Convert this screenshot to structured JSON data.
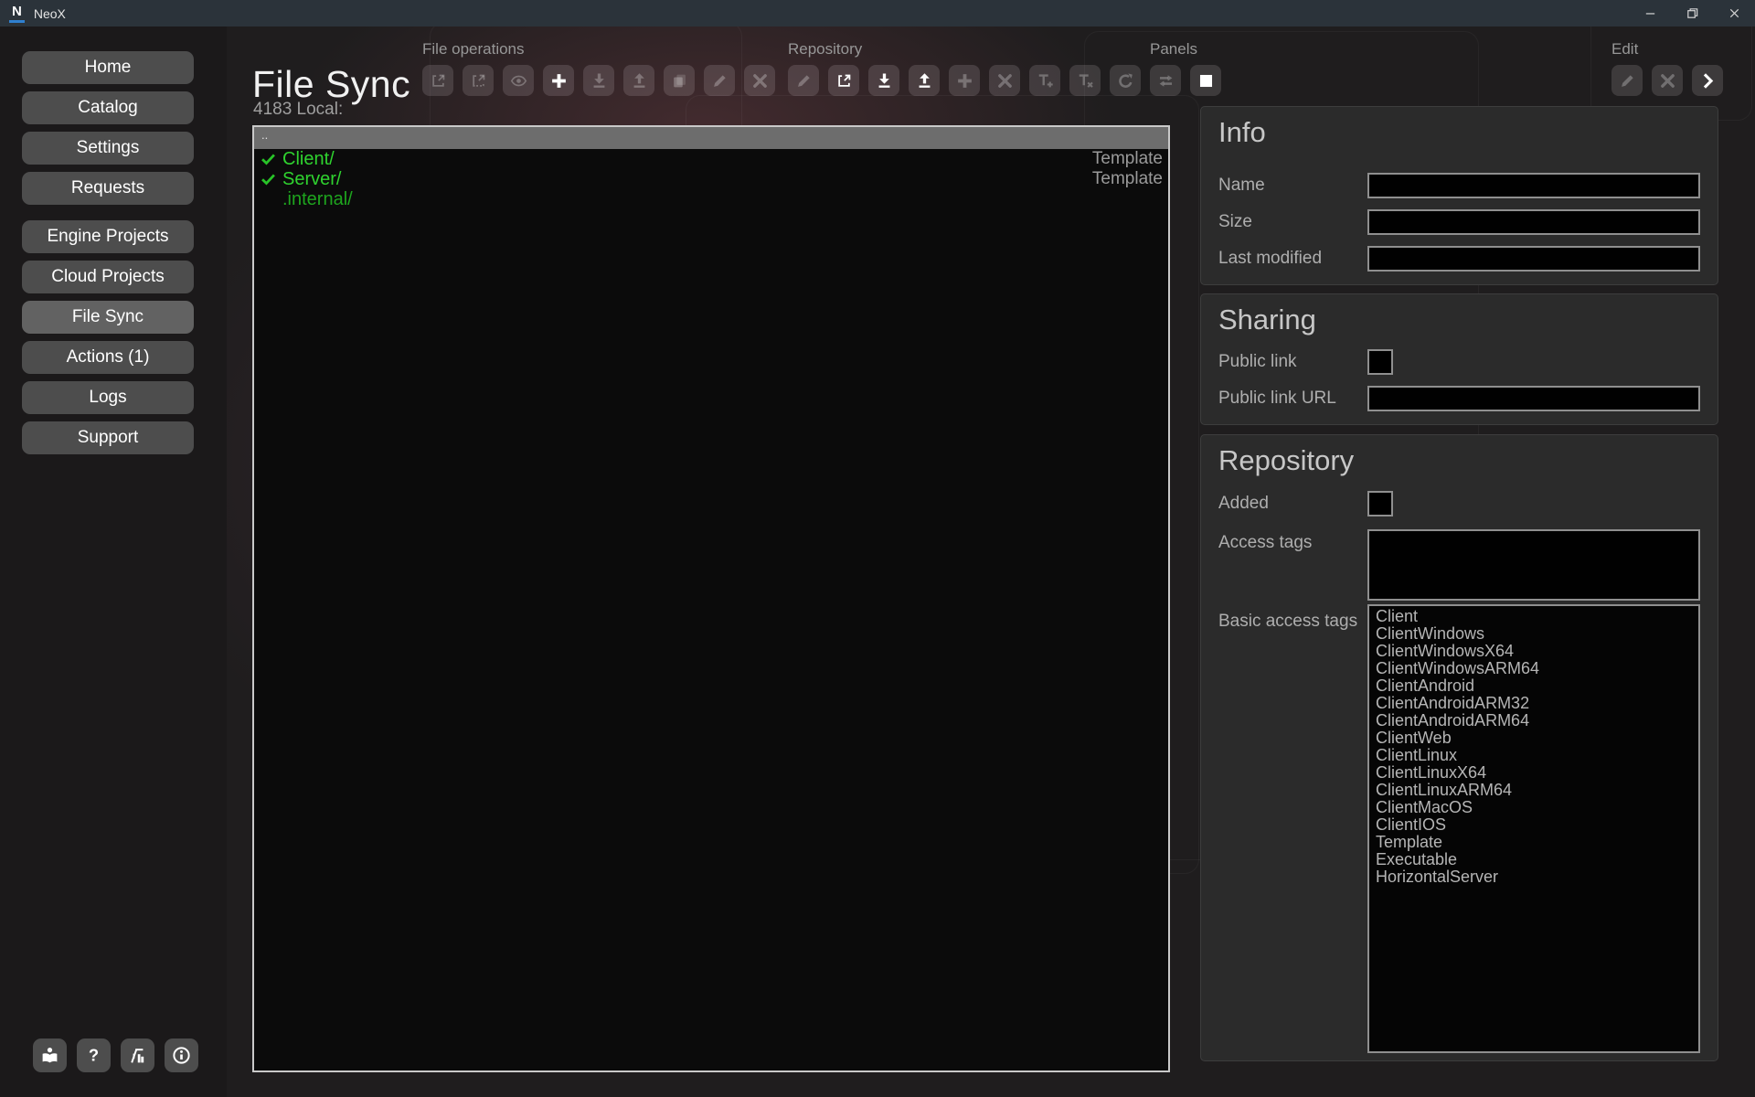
{
  "window": {
    "app_name": "NeoX",
    "logo_letter": "N",
    "controls": [
      "minimize",
      "restore",
      "close"
    ]
  },
  "page": {
    "title": "File Sync"
  },
  "sidebar": {
    "items": [
      {
        "label": "Home"
      },
      {
        "label": "Catalog"
      },
      {
        "label": "Settings"
      },
      {
        "label": "Requests"
      },
      {
        "label": "Engine Projects",
        "group_start": true
      },
      {
        "label": "Cloud Projects"
      },
      {
        "label": "File Sync",
        "active": true
      },
      {
        "label": "Actions (1)"
      },
      {
        "label": "Logs"
      },
      {
        "label": "Support"
      }
    ],
    "footer_icons": [
      "docs",
      "help",
      "build",
      "info"
    ]
  },
  "toolbar": {
    "groups": [
      {
        "label": "File operations",
        "buttons": [
          {
            "icon": "open-external",
            "bright": false
          },
          {
            "icon": "open-external-alt",
            "bright": false
          },
          {
            "icon": "eye",
            "bright": false
          },
          {
            "icon": "plus",
            "bright": true
          },
          {
            "icon": "download",
            "bright": false
          },
          {
            "icon": "upload",
            "bright": false
          },
          {
            "icon": "copy",
            "bright": false
          },
          {
            "icon": "pencil",
            "bright": false
          },
          {
            "icon": "close",
            "bright": false
          }
        ]
      },
      {
        "label": "Repository",
        "buttons": [
          {
            "icon": "pencil",
            "bright": false
          },
          {
            "icon": "open-external",
            "bright": true
          },
          {
            "icon": "download",
            "bright": true
          },
          {
            "icon": "upload",
            "bright": true
          },
          {
            "icon": "plus",
            "bright": false
          },
          {
            "icon": "close",
            "bright": false
          },
          {
            "icon": "text-add",
            "bright": false
          },
          {
            "icon": "text-remove",
            "bright": false
          },
          {
            "icon": "reset",
            "bright": false
          }
        ]
      },
      {
        "label": "Panels",
        "buttons": [
          {
            "icon": "swap",
            "bright": false
          },
          {
            "icon": "square",
            "bright": true
          }
        ]
      },
      {
        "label": "Edit",
        "buttons": [
          {
            "icon": "pencil",
            "bright": false
          },
          {
            "icon": "close",
            "bright": false
          },
          {
            "icon": "chevron-right",
            "bright": true
          }
        ]
      }
    ]
  },
  "file_list": {
    "counter_label": "4183 Local:",
    "parent_entry": "..",
    "rows": [
      {
        "name": "Client/",
        "synced": true,
        "tag": "Template",
        "dim": false
      },
      {
        "name": "Server/",
        "synced": true,
        "tag": "Template",
        "dim": false
      },
      {
        "name": ".internal/",
        "synced": false,
        "tag": "",
        "dim": true
      }
    ]
  },
  "inspector": {
    "info": {
      "title": "Info",
      "fields": [
        {
          "label": "Name",
          "value": ""
        },
        {
          "label": "Size",
          "value": ""
        },
        {
          "label": "Last modified",
          "value": ""
        }
      ]
    },
    "sharing": {
      "title": "Sharing",
      "public_link_label": "Public link",
      "public_link_checked": false,
      "public_link_url_label": "Public link URL",
      "public_link_url_value": ""
    },
    "repository": {
      "title": "Repository",
      "added_label": "Added",
      "added_checked": false,
      "access_tags_label": "Access tags",
      "access_tags_value": "",
      "basic_access_tags_label": "Basic access tags",
      "basic_access_tags": [
        "Client",
        "ClientWindows",
        "ClientWindowsX64",
        "ClientWindowsARM64",
        "ClientAndroid",
        "ClientAndroidARM32",
        "ClientAndroidARM64",
        "ClientWeb",
        "ClientLinux",
        "ClientLinuxX64",
        "ClientLinuxARM64",
        "ClientMacOS",
        "ClientIOS",
        "Template",
        "Executable",
        "HorizontalServer"
      ]
    }
  },
  "colors": {
    "sync_green": "#2fd32f",
    "sync_green_dim": "#1ea51e",
    "accent_blue": "#2f80d0",
    "titlebar_bg": "#2b333a",
    "panel_bg": "#2b2b2b",
    "list_bg": "#0b0b0b"
  }
}
